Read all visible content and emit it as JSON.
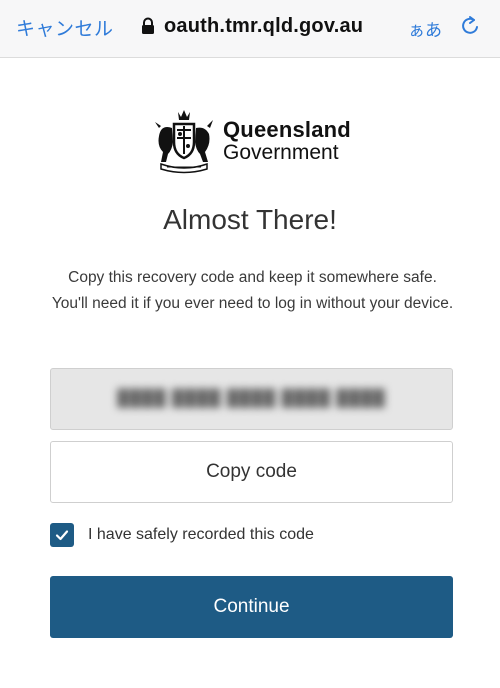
{
  "browser": {
    "cancel_label": "キャンセル",
    "url": "oauth.tmr.qld.gov.au",
    "text_size_label": "ぁあ",
    "lock_icon": "lock-icon",
    "reload_icon": "reload-icon",
    "accent_color": "#2f7bd9"
  },
  "logo": {
    "line1": "Queensland",
    "line2": "Government",
    "crest_icon": "queensland-crest-icon"
  },
  "page": {
    "title": "Almost There!",
    "description": "Copy this recovery code and keep it somewhere safe. You'll need it if you ever need to log in without your device."
  },
  "recovery": {
    "code": "",
    "copy_label": "Copy code"
  },
  "confirm": {
    "checked": true,
    "label": "I have safely recorded this code"
  },
  "actions": {
    "continue_label": "Continue",
    "primary_color": "#1e5b85"
  }
}
